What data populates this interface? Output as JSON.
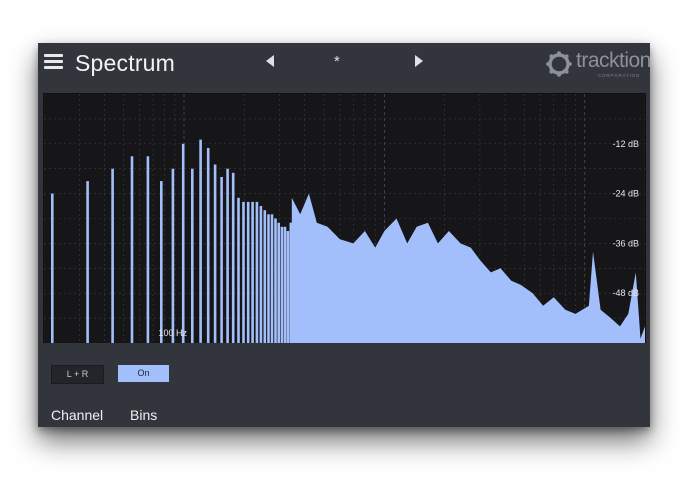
{
  "header": {
    "title": "Spectrum",
    "preset_name": "*",
    "brand": "tracktion",
    "brand_tagline": "CORPORATION"
  },
  "colors": {
    "panel": "#33353c",
    "plot_background": "#161619",
    "spectrum": "#a2bffb",
    "grid": "#3a3c44"
  },
  "icons": [
    "menu-icon",
    "chevron-left-icon",
    "chevron-right-icon",
    "tracktion-logo-icon"
  ],
  "spectrum": {
    "db_labels": [
      "-12 dB",
      "-24 dB",
      "-36 dB",
      "-48 dB"
    ],
    "freq_label": "100 Hz"
  },
  "chart_data": {
    "type": "bar",
    "title": "",
    "xlabel": "",
    "ylabel": "",
    "y_tick_labels": [
      "-12 dB",
      "-24 dB",
      "-36 dB",
      "-48 dB"
    ],
    "x_tick_labels": [
      "100 Hz"
    ],
    "x_scale": "log",
    "x_range_hz": [
      20,
      20000
    ],
    "y_range_db": [
      -60,
      0
    ],
    "grid": true,
    "bins": [
      {
        "hz": 22,
        "db": -24
      },
      {
        "hz": 33,
        "db": -21
      },
      {
        "hz": 44,
        "db": -18
      },
      {
        "hz": 55,
        "db": -15
      },
      {
        "hz": 66,
        "db": -15
      },
      {
        "hz": 77,
        "db": -21
      },
      {
        "hz": 88,
        "db": -18
      },
      {
        "hz": 99,
        "db": -12
      },
      {
        "hz": 110,
        "db": -18
      },
      {
        "hz": 121,
        "db": -11
      },
      {
        "hz": 132,
        "db": -13
      },
      {
        "hz": 143,
        "db": -17
      },
      {
        "hz": 154,
        "db": -20
      },
      {
        "hz": 165,
        "db": -18
      },
      {
        "hz": 176,
        "db": -19
      },
      {
        "hz": 187,
        "db": -25
      },
      {
        "hz": 198,
        "db": -26
      },
      {
        "hz": 209,
        "db": -26
      },
      {
        "hz": 220,
        "db": -26
      },
      {
        "hz": 231,
        "db": -26
      },
      {
        "hz": 242,
        "db": -27
      },
      {
        "hz": 253,
        "db": -28
      },
      {
        "hz": 264,
        "db": -29
      },
      {
        "hz": 275,
        "db": -29
      },
      {
        "hz": 286,
        "db": -30
      },
      {
        "hz": 297,
        "db": -31
      },
      {
        "hz": 308,
        "db": -32
      },
      {
        "hz": 319,
        "db": -32
      },
      {
        "hz": 330,
        "db": -33
      },
      {
        "hz": 341,
        "db": -31
      }
    ],
    "continuous_envelope": [
      {
        "hz": 345,
        "db": -25
      },
      {
        "hz": 380,
        "db": -29
      },
      {
        "hz": 420,
        "db": -24
      },
      {
        "hz": 460,
        "db": -31
      },
      {
        "hz": 520,
        "db": -32
      },
      {
        "hz": 600,
        "db": -35
      },
      {
        "hz": 700,
        "db": -36
      },
      {
        "hz": 800,
        "db": -33
      },
      {
        "hz": 900,
        "db": -37
      },
      {
        "hz": 1000,
        "db": -33
      },
      {
        "hz": 1150,
        "db": -30
      },
      {
        "hz": 1300,
        "db": -36
      },
      {
        "hz": 1450,
        "db": -32
      },
      {
        "hz": 1650,
        "db": -31
      },
      {
        "hz": 1850,
        "db": -36
      },
      {
        "hz": 2100,
        "db": -33
      },
      {
        "hz": 2400,
        "db": -36
      },
      {
        "hz": 2700,
        "db": -37
      },
      {
        "hz": 3000,
        "db": -40
      },
      {
        "hz": 3400,
        "db": -43
      },
      {
        "hz": 3800,
        "db": -42
      },
      {
        "hz": 4300,
        "db": -45
      },
      {
        "hz": 4800,
        "db": -46
      },
      {
        "hz": 5500,
        "db": -48
      },
      {
        "hz": 6200,
        "db": -51
      },
      {
        "hz": 7000,
        "db": -49
      },
      {
        "hz": 8000,
        "db": -52
      },
      {
        "hz": 9000,
        "db": -53
      },
      {
        "hz": 10500,
        "db": -51
      },
      {
        "hz": 11000,
        "db": -38
      },
      {
        "hz": 12000,
        "db": -52
      },
      {
        "hz": 13500,
        "db": -54
      },
      {
        "hz": 15000,
        "db": -56
      },
      {
        "hz": 16500,
        "db": -53
      },
      {
        "hz": 18000,
        "db": -43
      },
      {
        "hz": 19000,
        "db": -59
      },
      {
        "hz": 20000,
        "db": -56
      }
    ]
  },
  "controls": {
    "channel_value": "L + R",
    "channel_label": "Channel",
    "bins_value": "On",
    "bins_label": "Bins"
  }
}
